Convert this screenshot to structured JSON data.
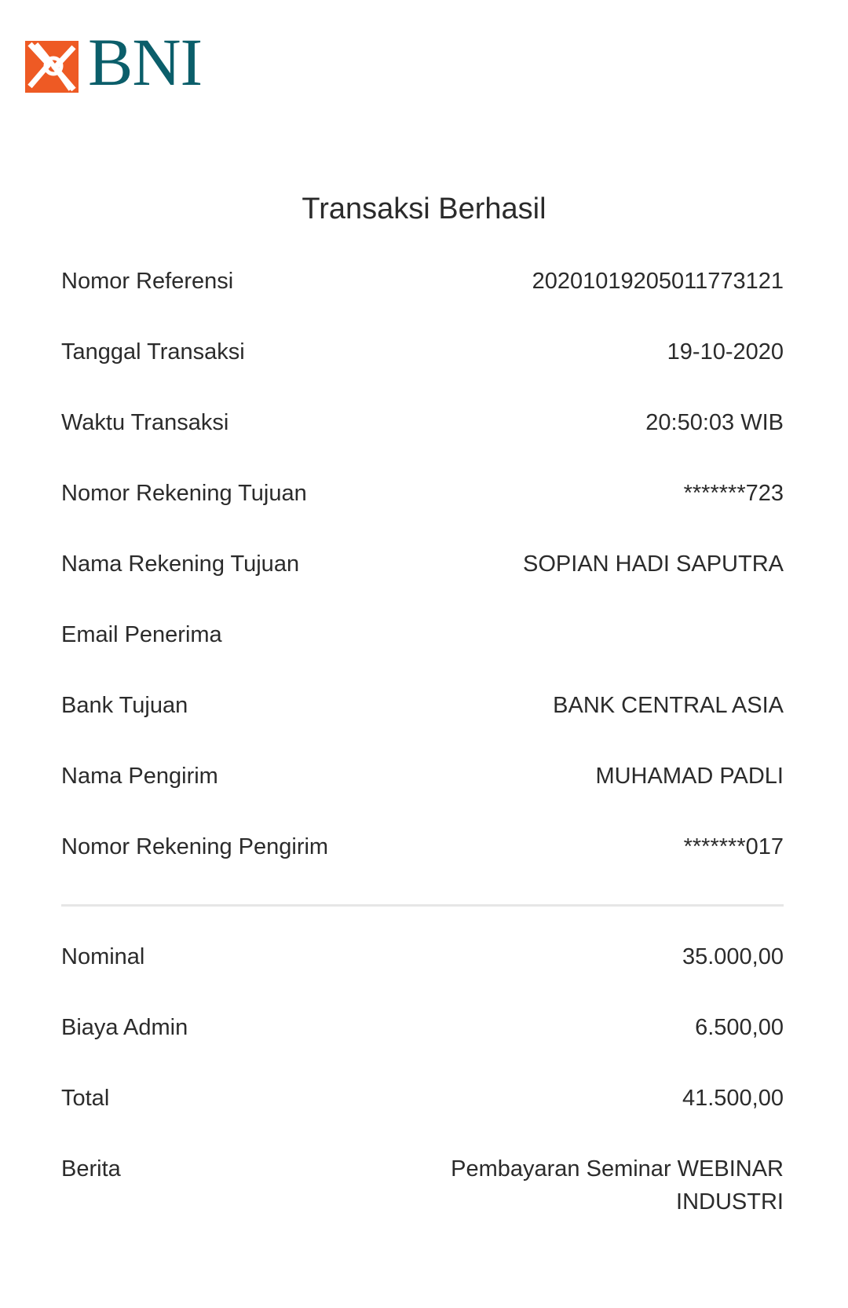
{
  "brand": {
    "name": "BNI",
    "colors": {
      "orange": "#ee5a24",
      "teal": "#0b5e6a"
    }
  },
  "title": "Transaksi Berhasil",
  "details": [
    {
      "label": "Nomor Referensi",
      "value": "20201019205011773121"
    },
    {
      "label": "Tanggal Transaksi",
      "value": "19-10-2020"
    },
    {
      "label": "Waktu Transaksi",
      "value": "20:50:03 WIB"
    },
    {
      "label": "Nomor Rekening Tujuan",
      "value": "*******723"
    },
    {
      "label": "Nama Rekening Tujuan",
      "value": "SOPIAN HADI SAPUTRA"
    },
    {
      "label": "Email Penerima",
      "value": ""
    },
    {
      "label": "Bank Tujuan",
      "value": "BANK CENTRAL ASIA"
    },
    {
      "label": "Nama Pengirim",
      "value": "MUHAMAD PADLI"
    },
    {
      "label": "Nomor Rekening Pengirim",
      "value": "*******017"
    }
  ],
  "amounts": [
    {
      "label": "Nominal",
      "value": "35.000,00"
    },
    {
      "label": "Biaya Admin",
      "value": "6.500,00"
    },
    {
      "label": "Total",
      "value": "41.500,00"
    },
    {
      "label": "Berita",
      "value": "Pembayaran Seminar WEBINAR INDUSTRI"
    }
  ]
}
